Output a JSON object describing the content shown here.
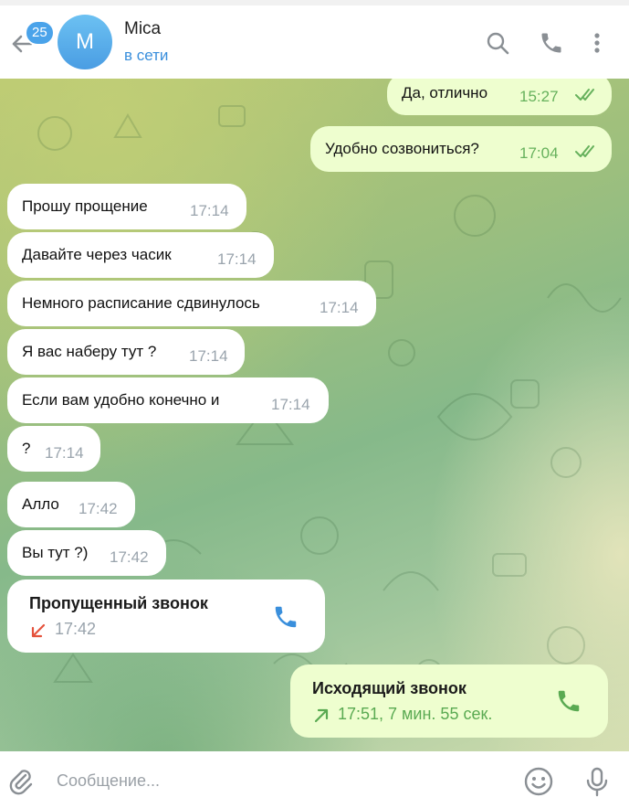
{
  "header": {
    "unread_count": "25",
    "avatar_letter": "M",
    "contact_name": "Mica",
    "status": "в сети"
  },
  "messages": [
    {
      "dir": "out",
      "text": "Да, отлично",
      "time": "15:27",
      "read": true
    },
    {
      "dir": "out",
      "text": "Удобно созвониться?",
      "time": "17:04",
      "read": true
    },
    {
      "dir": "in",
      "text": "Прошу прощение",
      "time": "17:14"
    },
    {
      "dir": "in",
      "text": "Давайте через часик",
      "time": "17:14"
    },
    {
      "dir": "in",
      "text": "Немного расписание сдвинулось",
      "time": "17:14"
    },
    {
      "dir": "in",
      "text": "Я вас наберу тут ?",
      "time": "17:14"
    },
    {
      "dir": "in",
      "text": "Если вам удобно конечно и",
      "time": "17:14"
    },
    {
      "dir": "in",
      "text": "?",
      "time": "17:14"
    },
    {
      "dir": "in",
      "text": "Алло",
      "time": "17:42"
    },
    {
      "dir": "in",
      "text": "Вы тут ?)",
      "time": "17:42"
    }
  ],
  "calls": [
    {
      "dir": "in",
      "title": "Пропущенный звонок",
      "detail": "17:42",
      "status": "missed",
      "arrow": "arrow-down-left-icon"
    },
    {
      "dir": "out",
      "title": "Исходящий звонок",
      "detail": "17:51, 7 мин. 55 сек.",
      "status": "outgoing",
      "arrow": "arrow-up-right-icon"
    }
  ],
  "composer": {
    "placeholder": "Сообщение..."
  },
  "colors": {
    "accent": "#3a8fdc",
    "outgoing_bubble": "#eefecf",
    "incoming_bubble": "#ffffff",
    "missed_red": "#e5533d",
    "outgoing_green": "#5aaa52"
  }
}
